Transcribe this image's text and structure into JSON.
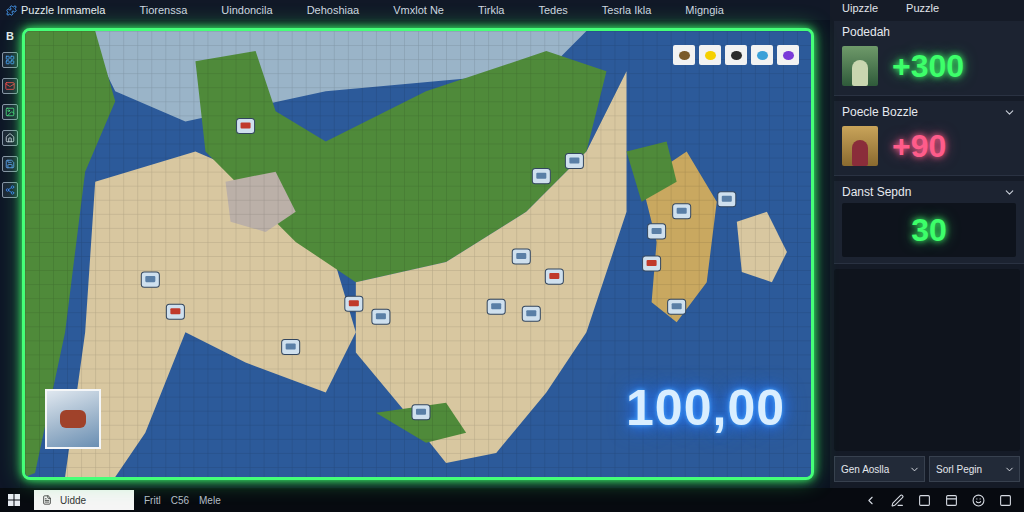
{
  "app_bar": {
    "title": "Puzzle Inmamela",
    "menu": [
      "Tiorenssa",
      "Uindoncila",
      "Dehoshiaa",
      "Vmxlot Ne",
      "Tirkla",
      "Tedes",
      "Tesrla Ikla",
      "Migngia"
    ]
  },
  "sidebar": {
    "letter": "B"
  },
  "board": {
    "score": "100,00"
  },
  "panel": {
    "header": [
      "Uipzzle",
      "Puzzle"
    ],
    "cards": [
      {
        "title": "Podedah",
        "value": "+300",
        "color": "#3dff6a",
        "kind": "avatar",
        "collapsible": false
      },
      {
        "title": "Poecle Bozzle",
        "value": "+90",
        "color": "#ff5c8a",
        "kind": "avatar",
        "collapsible": true
      },
      {
        "title": "Danst Sepdn",
        "value": "30",
        "color": "#3dff6a",
        "kind": "counter",
        "collapsible": true
      }
    ],
    "dropdowns": [
      "Gen Aoslla",
      "Sorl Pegin"
    ]
  },
  "taskbar": {
    "search": "Uidde",
    "items": [
      "Fritl",
      "C56",
      "Mele"
    ]
  }
}
